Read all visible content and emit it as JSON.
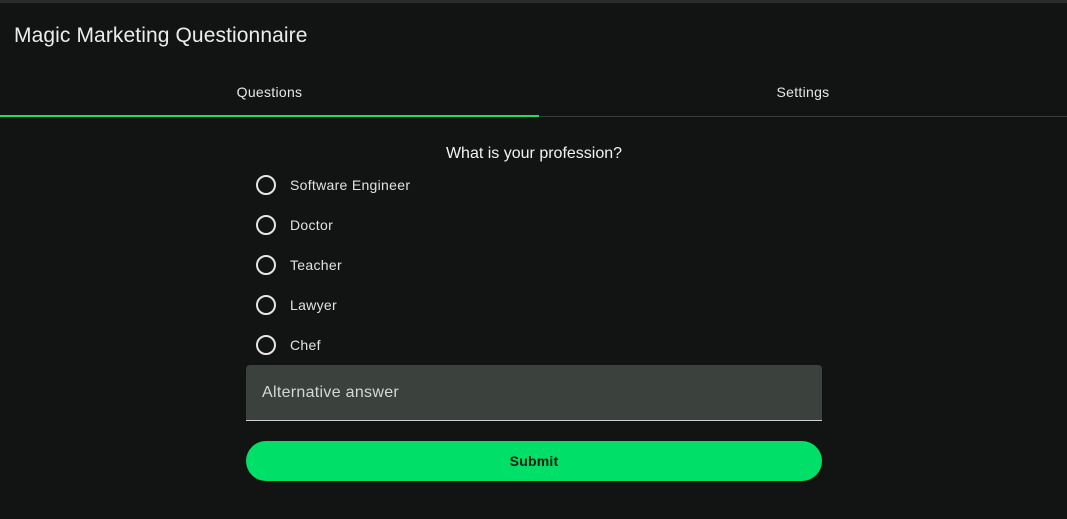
{
  "app": {
    "title": "Magic Marketing Questionnaire"
  },
  "tabs": [
    {
      "label": "Questions",
      "active": true
    },
    {
      "label": "Settings",
      "active": false
    }
  ],
  "question": {
    "text": "What is your profession?",
    "options": [
      {
        "label": "Software Engineer",
        "selected": false
      },
      {
        "label": "Doctor",
        "selected": false
      },
      {
        "label": "Teacher",
        "selected": false
      },
      {
        "label": "Lawyer",
        "selected": false
      },
      {
        "label": "Chef",
        "selected": false
      }
    ],
    "alternative": {
      "placeholder": "Alternative answer",
      "value": ""
    }
  },
  "submit_label": "Submit",
  "colors": {
    "accent": "#00df68",
    "background": "#121413",
    "field_background": "#3b413c"
  }
}
